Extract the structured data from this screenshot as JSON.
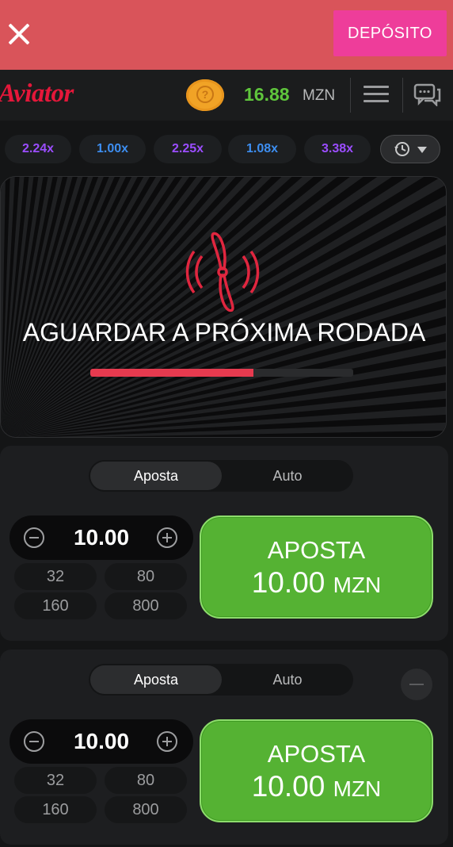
{
  "topbar": {
    "close_icon": "close-icon",
    "deposit_label": "DEPÓSITO"
  },
  "header": {
    "logo": "Aviator",
    "coin_icon": "question-coin-icon",
    "balance": "16.88",
    "currency": "MZN",
    "menu_icon": "hamburger-menu-icon",
    "chat_icon": "chat-bubbles-icon"
  },
  "history": {
    "multipliers": [
      {
        "value": "2.24x",
        "color": "#9b4dff"
      },
      {
        "value": "1.00x",
        "color": "#3d8ef0"
      },
      {
        "value": "2.25x",
        "color": "#9b4dff"
      },
      {
        "value": "1.08x",
        "color": "#3d8ef0"
      },
      {
        "value": "3.38x",
        "color": "#9b4dff"
      }
    ],
    "history_icon": "clock-history-icon"
  },
  "game": {
    "status_text": "AGUARDAR A PRÓXIMA RODADA",
    "progress_fraction": 0.62,
    "propeller_icon": "propeller-icon",
    "accent": "#e63a4f"
  },
  "panels": [
    {
      "tabs": [
        "Aposta",
        "Auto"
      ],
      "amount": "10.00",
      "quick": [
        "32",
        "80",
        "160",
        "800"
      ],
      "bet_title": "APOSTA",
      "bet_amount": "10.00",
      "bet_currency": "MZN"
    },
    {
      "tabs": [
        "Aposta",
        "Auto"
      ],
      "amount": "10.00",
      "quick": [
        "32",
        "80",
        "160",
        "800"
      ],
      "bet_title": "APOSTA",
      "bet_amount": "10.00",
      "bet_currency": "MZN"
    }
  ]
}
